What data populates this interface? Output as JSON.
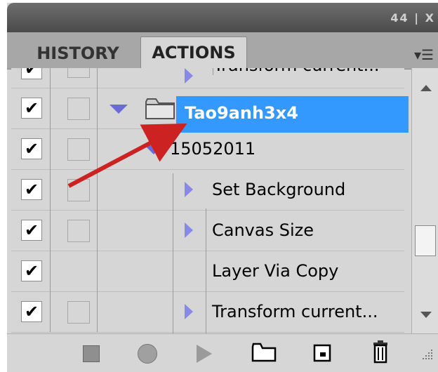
{
  "panel": {
    "controls_text": "44 | X",
    "tabs": [
      {
        "label": "HISTORY",
        "active": false
      },
      {
        "label": "ACTIONS",
        "active": true
      }
    ],
    "menu_icon": "panel-menu-icon"
  },
  "actions": [
    {
      "label": "Transform current...",
      "checked": true,
      "dialog": true,
      "expand": "right",
      "level": 2,
      "partial": true
    },
    {
      "label": "Tao9anh3x4",
      "checked": true,
      "dialog": true,
      "expand": "down",
      "level": 0,
      "type": "set",
      "selected": true
    },
    {
      "label": "15052011",
      "checked": true,
      "dialog": true,
      "expand": "down",
      "level": 1,
      "type": "action"
    },
    {
      "label": "Set Background",
      "checked": true,
      "dialog": true,
      "expand": "right",
      "level": 2
    },
    {
      "label": "Canvas Size",
      "checked": true,
      "dialog": true,
      "expand": "right",
      "level": 2
    },
    {
      "label": "Layer Via Copy",
      "checked": true,
      "dialog": false,
      "expand": "none",
      "level": 2
    },
    {
      "label": "Transform current...",
      "checked": true,
      "dialog": true,
      "expand": "right",
      "level": 2
    }
  ],
  "bottom_toolbar": [
    {
      "icon": "stop-icon",
      "label": "Stop playing/recording"
    },
    {
      "icon": "record-icon",
      "label": "Begin recording"
    },
    {
      "icon": "play-icon",
      "label": "Play selection"
    },
    {
      "icon": "new-set-icon",
      "label": "Create new set"
    },
    {
      "icon": "new-action-icon",
      "label": "Create new action"
    },
    {
      "icon": "trash-icon",
      "label": "Delete"
    }
  ],
  "colors": {
    "selection": "#3399ff",
    "triangle": "#8888e8",
    "annotation_arrow": "#cc2222"
  }
}
